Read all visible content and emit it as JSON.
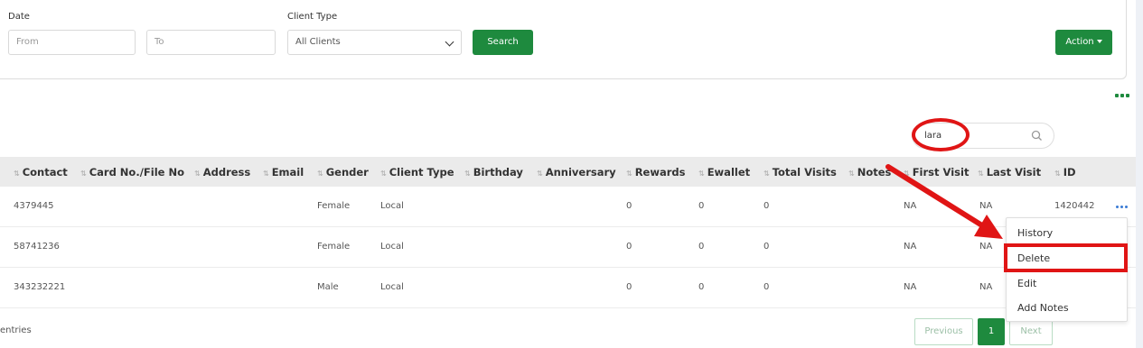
{
  "filters": {
    "date_label": "Date",
    "from_placeholder": "From",
    "to_placeholder": "To",
    "client_type_label": "Client Type",
    "client_type_selected": "All Clients",
    "search_button": "Search",
    "action_button": "Action"
  },
  "search": {
    "value": "lara"
  },
  "table": {
    "columns": [
      "Contact",
      "Card No./File No",
      "Address",
      "Email",
      "Gender",
      "Client Type",
      "Birthday",
      "Anniversary",
      "Rewards",
      "Ewallet",
      "Total Visits",
      "Notes",
      "First Visit",
      "Last Visit",
      "ID"
    ],
    "rows": [
      {
        "contact": "4379445",
        "gender": "Female",
        "client_type": "Local",
        "rewards": "0",
        "ewallet": "0",
        "total_visits": "0",
        "first_visit": "NA",
        "last_visit": "NA",
        "id": "1420442"
      },
      {
        "contact": "58741236",
        "gender": "Female",
        "client_type": "Local",
        "rewards": "0",
        "ewallet": "0",
        "total_visits": "0",
        "first_visit": "NA",
        "last_visit": "NA",
        "id": ""
      },
      {
        "contact": "343232221",
        "gender": "Male",
        "client_type": "Local",
        "rewards": "0",
        "ewallet": "0",
        "total_visits": "0",
        "first_visit": "NA",
        "last_visit": "NA",
        "id": ""
      }
    ]
  },
  "footer": {
    "entries_text": "entries"
  },
  "pagination": {
    "previous": "Previous",
    "current": "1",
    "next": "Next"
  },
  "row_menu": {
    "items": [
      "History",
      "Delete",
      "Edit",
      "Add Notes"
    ]
  },
  "colors": {
    "brand_green": "#1e8a3e",
    "annotation_red": "#e01515"
  }
}
